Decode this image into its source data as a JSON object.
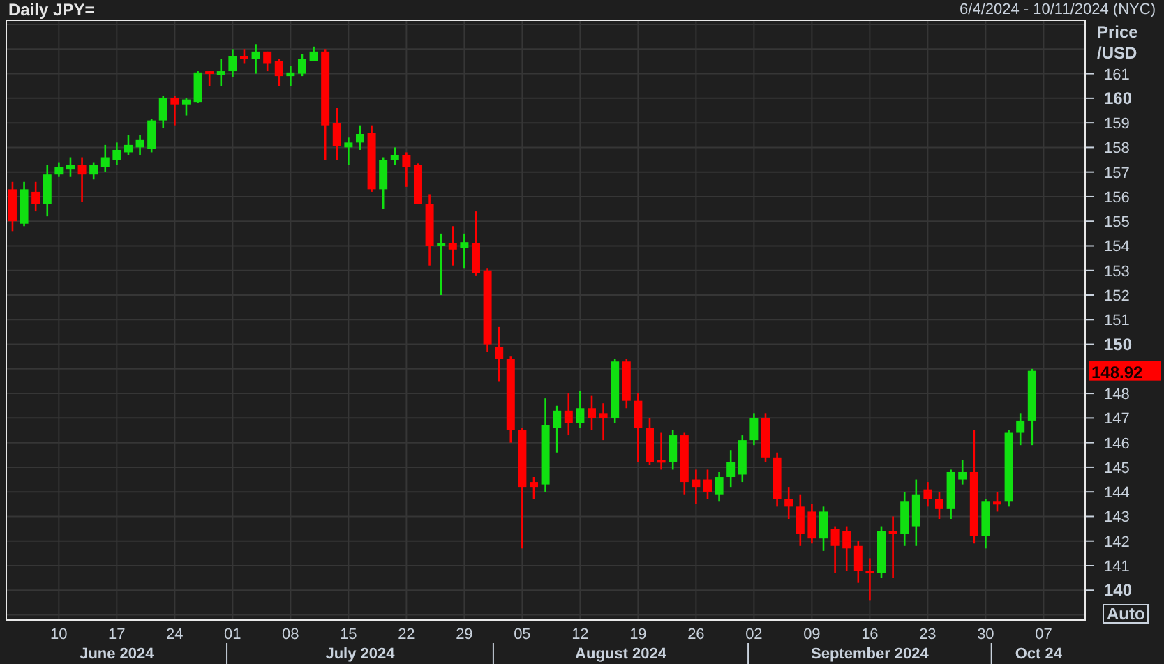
{
  "header": {
    "title": "Daily JPY=",
    "date_range": "6/4/2024 - 10/11/2024 (NYC)"
  },
  "chart": {
    "chart_data": {
      "type": "candlestick",
      "ylabel": "Price /USD",
      "grid": true,
      "ylim": [
        138.76,
        163.2
      ],
      "yticks": [
        140,
        141,
        142,
        143,
        144,
        145,
        146,
        147,
        148,
        150,
        151,
        152,
        153,
        154,
        155,
        156,
        157,
        158,
        159,
        160,
        161
      ],
      "categories": [
        null,
        null,
        null,
        null,
        "10",
        null,
        null,
        null,
        null,
        "17",
        null,
        null,
        null,
        null,
        "24",
        null,
        null,
        null,
        null,
        "01",
        null,
        null,
        null,
        null,
        "08",
        null,
        null,
        null,
        null,
        "15",
        null,
        null,
        null,
        null,
        "22",
        null,
        null,
        null,
        null,
        "29",
        null,
        null,
        null,
        null,
        "05",
        null,
        null,
        null,
        null,
        "12",
        null,
        null,
        null,
        null,
        "19",
        null,
        null,
        null,
        null,
        "26",
        null,
        null,
        null,
        null,
        "02",
        null,
        null,
        null,
        null,
        "09",
        null,
        null,
        null,
        null,
        "16",
        null,
        null,
        null,
        null,
        "23",
        null,
        null,
        null,
        null,
        "30",
        null,
        null,
        null,
        null,
        "07",
        null,
        null,
        null
      ],
      "ohlc": [
        [
          156.3,
          156.6,
          154.6,
          155.0
        ],
        [
          154.9,
          156.6,
          154.8,
          156.3
        ],
        [
          156.2,
          156.6,
          155.4,
          155.7
        ],
        [
          155.7,
          157.3,
          155.2,
          156.9
        ],
        [
          156.9,
          157.4,
          156.8,
          157.2
        ],
        [
          157.1,
          157.6,
          156.8,
          157.3
        ],
        [
          157.3,
          157.6,
          155.8,
          156.9
        ],
        [
          156.9,
          157.4,
          156.7,
          157.3
        ],
        [
          157.2,
          158.1,
          157.0,
          157.6
        ],
        [
          157.5,
          158.2,
          157.3,
          157.9
        ],
        [
          157.8,
          158.5,
          157.7,
          158.1
        ],
        [
          158.0,
          158.5,
          157.7,
          158.3
        ],
        [
          157.95,
          159.15,
          157.8,
          159.1
        ],
        [
          159.1,
          160.1,
          158.8,
          160.0
        ],
        [
          160.0,
          160.1,
          158.9,
          159.75
        ],
        [
          159.75,
          160.0,
          159.3,
          159.95
        ],
        [
          159.85,
          161.1,
          159.8,
          161.05
        ],
        [
          161.1,
          161.1,
          160.5,
          161.0
        ],
        [
          160.95,
          161.6,
          160.5,
          161.1
        ],
        [
          161.1,
          162.0,
          160.85,
          161.7
        ],
        [
          161.7,
          162.0,
          161.4,
          161.6
        ],
        [
          161.6,
          162.2,
          161.0,
          161.9
        ],
        [
          161.9,
          161.9,
          161.1,
          161.4
        ],
        [
          161.5,
          161.6,
          160.5,
          160.9
        ],
        [
          160.9,
          161.3,
          160.5,
          161.05
        ],
        [
          161.0,
          161.8,
          160.9,
          161.6
        ],
        [
          161.5,
          162.1,
          161.5,
          161.9
        ],
        [
          161.9,
          162.0,
          157.5,
          158.9
        ],
        [
          159.0,
          159.6,
          157.5,
          158.05
        ],
        [
          158.0,
          158.4,
          157.3,
          158.2
        ],
        [
          158.2,
          158.9,
          157.9,
          158.55
        ],
        [
          158.6,
          158.9,
          156.2,
          156.3
        ],
        [
          156.3,
          157.6,
          155.5,
          157.5
        ],
        [
          157.5,
          158.0,
          157.3,
          157.7
        ],
        [
          157.7,
          157.8,
          156.4,
          157.2
        ],
        [
          157.3,
          157.35,
          155.7,
          155.7
        ],
        [
          155.7,
          156.1,
          153.2,
          154.0
        ],
        [
          154.0,
          154.5,
          152.0,
          154.1
        ],
        [
          154.1,
          154.8,
          153.2,
          153.85
        ],
        [
          153.9,
          154.5,
          153.1,
          154.15
        ],
        [
          154.1,
          155.4,
          152.8,
          152.9
        ],
        [
          153.0,
          153.1,
          149.7,
          150.0
        ],
        [
          149.9,
          150.7,
          148.5,
          149.4
        ],
        [
          149.4,
          149.5,
          146.0,
          146.5
        ],
        [
          146.5,
          146.6,
          141.7,
          144.2
        ],
        [
          144.4,
          144.6,
          143.7,
          144.2
        ],
        [
          144.3,
          147.8,
          144.0,
          146.7
        ],
        [
          146.6,
          147.5,
          145.6,
          147.3
        ],
        [
          147.3,
          148.0,
          146.3,
          146.8
        ],
        [
          146.8,
          148.1,
          146.6,
          147.4
        ],
        [
          147.4,
          147.9,
          146.5,
          147.0
        ],
        [
          147.2,
          147.6,
          146.1,
          147.0
        ],
        [
          147.0,
          149.4,
          146.8,
          149.3
        ],
        [
          149.3,
          149.4,
          147.4,
          147.7
        ],
        [
          147.7,
          148.0,
          145.2,
          146.6
        ],
        [
          146.6,
          147.0,
          145.1,
          145.2
        ],
        [
          145.3,
          146.4,
          144.9,
          145.2
        ],
        [
          145.2,
          146.5,
          144.9,
          146.3
        ],
        [
          146.3,
          146.4,
          143.9,
          144.4
        ],
        [
          144.5,
          144.9,
          143.5,
          144.2
        ],
        [
          144.5,
          144.9,
          143.7,
          144.0
        ],
        [
          143.9,
          144.8,
          143.6,
          144.6
        ],
        [
          144.6,
          145.7,
          144.2,
          145.2
        ],
        [
          144.7,
          146.3,
          144.4,
          146.1
        ],
        [
          146.1,
          147.2,
          145.9,
          147.0
        ],
        [
          147.0,
          147.2,
          145.2,
          145.4
        ],
        [
          145.4,
          145.6,
          143.4,
          143.7
        ],
        [
          143.7,
          144.2,
          142.9,
          143.4
        ],
        [
          143.4,
          143.9,
          141.8,
          142.3
        ],
        [
          143.2,
          143.5,
          141.9,
          142.1
        ],
        [
          142.1,
          143.4,
          141.6,
          143.2
        ],
        [
          142.5,
          142.6,
          140.7,
          141.8
        ],
        [
          142.4,
          142.6,
          140.8,
          141.7
        ],
        [
          141.8,
          142.0,
          140.3,
          140.8
        ],
        [
          140.8,
          141.3,
          139.6,
          140.7
        ],
        [
          140.7,
          142.6,
          140.5,
          142.4
        ],
        [
          142.4,
          143.0,
          140.5,
          142.3
        ],
        [
          142.3,
          144.0,
          141.8,
          143.6
        ],
        [
          142.6,
          144.5,
          141.8,
          143.9
        ],
        [
          144.1,
          144.4,
          143.4,
          143.7
        ],
        [
          143.7,
          144.0,
          142.9,
          143.3
        ],
        [
          143.3,
          144.9,
          142.9,
          144.8
        ],
        [
          144.5,
          145.3,
          144.3,
          144.8
        ],
        [
          144.8,
          146.5,
          141.9,
          142.2
        ],
        [
          142.2,
          143.7,
          141.7,
          143.6
        ],
        [
          143.6,
          144.0,
          143.2,
          143.5
        ],
        [
          143.6,
          146.5,
          143.4,
          146.4
        ],
        [
          146.4,
          147.2,
          145.9,
          146.9
        ],
        [
          146.9,
          149.0,
          145.9,
          148.92
        ],
        null,
        null,
        null,
        null
      ],
      "annotations": [
        "148.92"
      ]
    },
    "month_labels": [
      "June 2024",
      "July 2024",
      "August 2024",
      "September 2024",
      "Oct 24"
    ],
    "auto_button": "Auto"
  }
}
